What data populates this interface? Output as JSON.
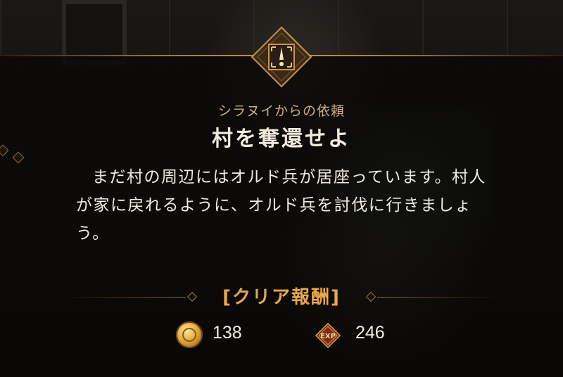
{
  "quest": {
    "giver": "シラヌイからの依頼",
    "title": "村を奪還せよ",
    "description": "まだ村の周辺にはオルド兵が居座っています。村人が家に戻れるように、オルド兵を討伐に行きましょう。"
  },
  "reward": {
    "label": "[クリア報酬]",
    "gold": "138",
    "exp": "246",
    "exp_badge": "EXP"
  },
  "icons": {
    "emblem": "exclamation-icon",
    "gold": "gold-coin-icon",
    "exp": "exp-badge-icon"
  },
  "colors": {
    "accent_gold": "#e6a84a",
    "frame_gold": "#a87a3c",
    "text_light": "#f0ebe3",
    "subtitle": "#c9ad86"
  }
}
